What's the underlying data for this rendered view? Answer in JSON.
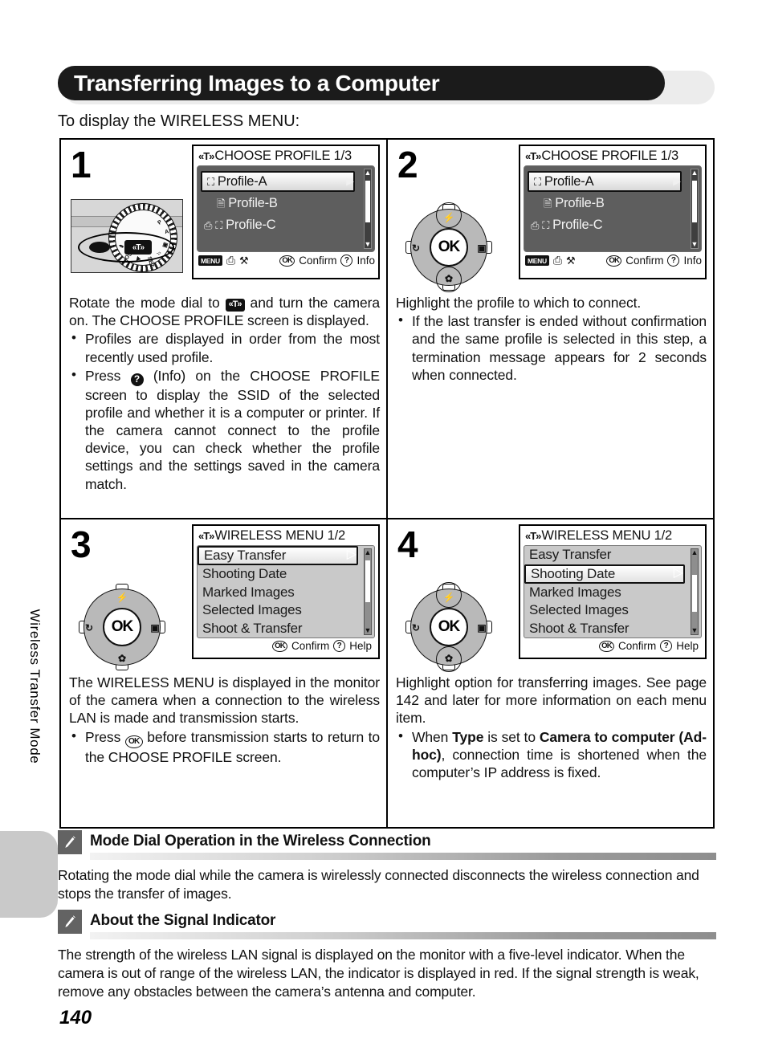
{
  "page": {
    "title": "Transferring Images to a Computer",
    "intro": "To display the WIRELESS MENU:",
    "number": "140",
    "side_label": "Wireless Transfer Mode"
  },
  "icons": {
    "wifi": "wireless-antenna-icon",
    "pencil": "pencil-note-icon",
    "question": "question-info-icon",
    "ok": "ok-button-icon",
    "menu": "MENU",
    "printer": "printer-icon",
    "wrench": "setup-wrench-icon",
    "computer": "computer-icon",
    "document": "document-icon",
    "flash": "flash-icon",
    "macro": "macro-flower-icon",
    "self_timer": "self-timer-icon",
    "exposure": "exposure-compensation-icon",
    "arrow_right": "▶",
    "arrow_up": "▲",
    "arrow_down": "▼"
  },
  "steps": [
    {
      "number": "1",
      "art": "mode-dial",
      "screen": {
        "style": "dark",
        "title": "CHOOSE PROFILE 1/3",
        "items": [
          {
            "label": "Profile-A",
            "icon": "computer",
            "selected": true
          },
          {
            "label": "Profile-B",
            "icon": "document",
            "selected": false
          },
          {
            "label": "Profile-C",
            "icon": "printer-computer",
            "selected": false
          }
        ],
        "footer_left": [
          "MENU",
          "printer",
          "wrench"
        ],
        "footer_ok": "Confirm",
        "footer_help": "Info"
      },
      "body": {
        "lead_pre": "Rotate the mode dial to ",
        "lead_post": " and turn the camera on. The CHOOSE PROFILE screen is displayed.",
        "bullets": [
          {
            "text": "Profiles are displayed in order from the most recently used profile."
          },
          {
            "pre": "Press ",
            "post": " (Info) on the CHOOSE PROFILE screen to display the SSID of the selected profile and whether it is a computer or printer. If the camera cannot connect to the profile device, you can check whether the profile settings and the settings saved in the camera match."
          }
        ]
      }
    },
    {
      "number": "2",
      "art": "multi-selector",
      "screen": {
        "style": "dark",
        "title": "CHOOSE PROFILE 1/3",
        "items": [
          {
            "label": "Profile-A",
            "icon": "computer",
            "selected": true
          },
          {
            "label": "Profile-B",
            "icon": "document",
            "selected": false
          },
          {
            "label": "Profile-C",
            "icon": "printer-computer",
            "selected": false
          }
        ],
        "footer_left": [
          "MENU",
          "printer",
          "wrench"
        ],
        "footer_ok": "Confirm",
        "footer_help": "Info"
      },
      "body": {
        "lead": "Highlight the profile to which to connect.",
        "bullets": [
          {
            "text": "If the last transfer is ended without confirmation and the same profile is selected in this step, a termination message appears for 2 seconds when connected."
          }
        ]
      }
    },
    {
      "number": "3",
      "art": "multi-selector",
      "screen": {
        "style": "light",
        "title": "WIRELESS MENU 1/2",
        "items": [
          {
            "label": "Easy Transfer",
            "selected": true
          },
          {
            "label": "Shooting Date",
            "selected": false
          },
          {
            "label": "Marked Images",
            "selected": false
          },
          {
            "label": "Selected Images",
            "selected": false
          },
          {
            "label": "Shoot & Transfer",
            "selected": false
          }
        ],
        "footer_ok": "Confirm",
        "footer_help": "Help"
      },
      "body": {
        "lead": "The WIRELESS MENU is displayed in the monitor of the camera when a connection to the wireless LAN is made and transmission starts.",
        "bullets": [
          {
            "pre": "Press ",
            "post": " before transmission starts to return to the CHOOSE PROFILE screen."
          }
        ]
      }
    },
    {
      "number": "4",
      "art": "multi-selector",
      "screen": {
        "style": "light",
        "title": "WIRELESS MENU 1/2",
        "items": [
          {
            "label": "Easy Transfer",
            "selected": false
          },
          {
            "label": "Shooting Date",
            "selected": true
          },
          {
            "label": "Marked Images",
            "selected": false
          },
          {
            "label": "Selected Images",
            "selected": false
          },
          {
            "label": "Shoot & Transfer",
            "selected": false
          }
        ],
        "footer_ok": "Confirm",
        "footer_help": "Help"
      },
      "body": {
        "lead": "Highlight option for transferring images. See page 142 and later for more information on each menu item.",
        "bullets": [
          {
            "pre": "When ",
            "bold1": "Type",
            "mid": " is set to ",
            "bold2": "Camera to computer (Ad-hoc)",
            "post": ", connection time is shortened when the computer’s IP address is fixed."
          }
        ]
      }
    }
  ],
  "notes": [
    {
      "title": "Mode Dial Operation in the Wireless Connection",
      "text": "Rotating the mode dial while the camera is wirelessly connected disconnects the wireless connection and stops the transfer of images."
    },
    {
      "title": "About the Signal Indicator",
      "text": "The strength of the wireless LAN signal is displayed on the monitor with a five-level indicator. When the camera is out of range of the wireless LAN, the indicator is displayed in red. If the signal strength is weak, remove any obstacles between the camera’s antenna and computer."
    }
  ],
  "colors": {
    "title_bar": "#1b1b1b",
    "note_icon_box": "#636363",
    "lcd_dark": "#5e5e5e",
    "lcd_light": "#c9c9c9",
    "side_tab": "#c9c9c9"
  }
}
